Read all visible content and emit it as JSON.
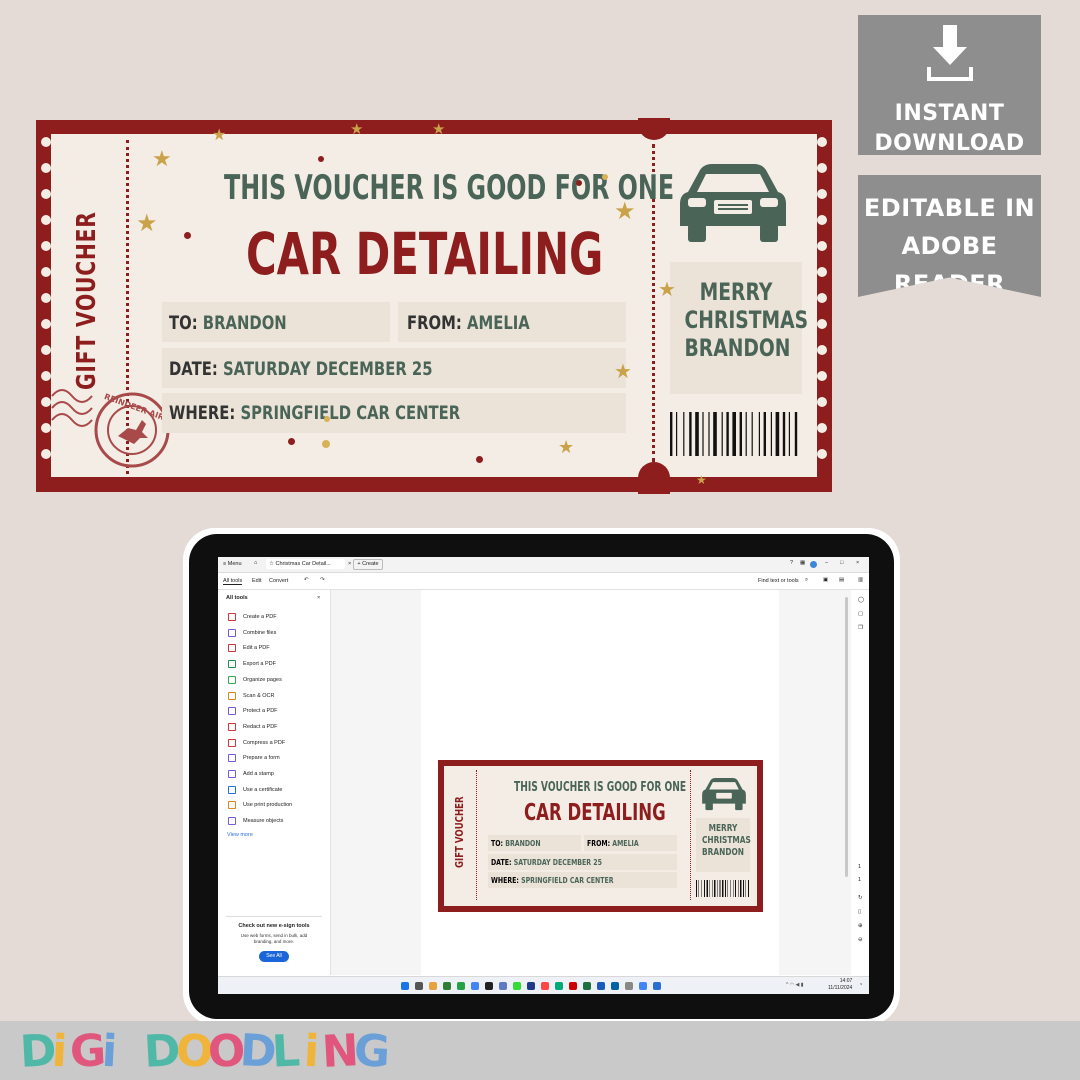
{
  "badges": {
    "download": {
      "line1": "INSTANT",
      "line2": "DOWNLOAD"
    },
    "editable": {
      "line1": "EDITABLE IN",
      "line2": "ADOBE READER"
    }
  },
  "voucher": {
    "side_label": "GIFT VOUCHER",
    "stamp_text": "REINDEER AIR MAIL",
    "headline": "THIS VOUCHER IS GOOD FOR ONE",
    "title": "CAR DETAILING",
    "to_label": "TO:",
    "to_value": "BRANDON",
    "from_label": "FROM:",
    "from_value": "AMELIA",
    "date_label": "DATE:",
    "date_value": "SATURDAY DECEMBER 25",
    "where_label": "WHERE:",
    "where_value": "SPRINGFIELD CAR CENTER",
    "message_line1": "MERRY",
    "message_line2": "CHRISTMAS",
    "message_line3": "BRANDON",
    "icon": "car-icon",
    "colors": {
      "red": "#8e1d1d",
      "paper": "#f3ede6",
      "green": "#4a6458",
      "gold": "#c9a24a",
      "field": "#ebe3d8"
    }
  },
  "app": {
    "menu_label": "Menu",
    "tab_title": "Christmas Car Detail...",
    "create_label": "Create",
    "toolbar": {
      "all_tools": "All tools",
      "edit": "Edit",
      "convert": "Convert",
      "find": "Find text or tools"
    },
    "panel_title": "All tools",
    "tools": [
      "Create a PDF",
      "Combine files",
      "Edit a PDF",
      "Export a PDF",
      "Organize pages",
      "Scan & OCR",
      "Protect a PDF",
      "Redact a PDF",
      "Compress a PDF",
      "Prepare a form",
      "Add a stamp",
      "Use a certificate",
      "Use print production",
      "Measure objects"
    ],
    "view_more": "View more",
    "promo_title": "Check out new e-sign tools",
    "promo_body": "Use web forms, send in bulk, add branding, and more.",
    "promo_button": "See All",
    "page_numbers": [
      "1",
      "1"
    ],
    "clock_time": "14:07",
    "clock_date": "11/11/2024"
  },
  "brand": {
    "logo": "DiGi DOODLiNG",
    "logo_colors": [
      "#4fb8a6",
      "#f0b43a",
      "#e0567c",
      "#6a9fd8"
    ]
  }
}
